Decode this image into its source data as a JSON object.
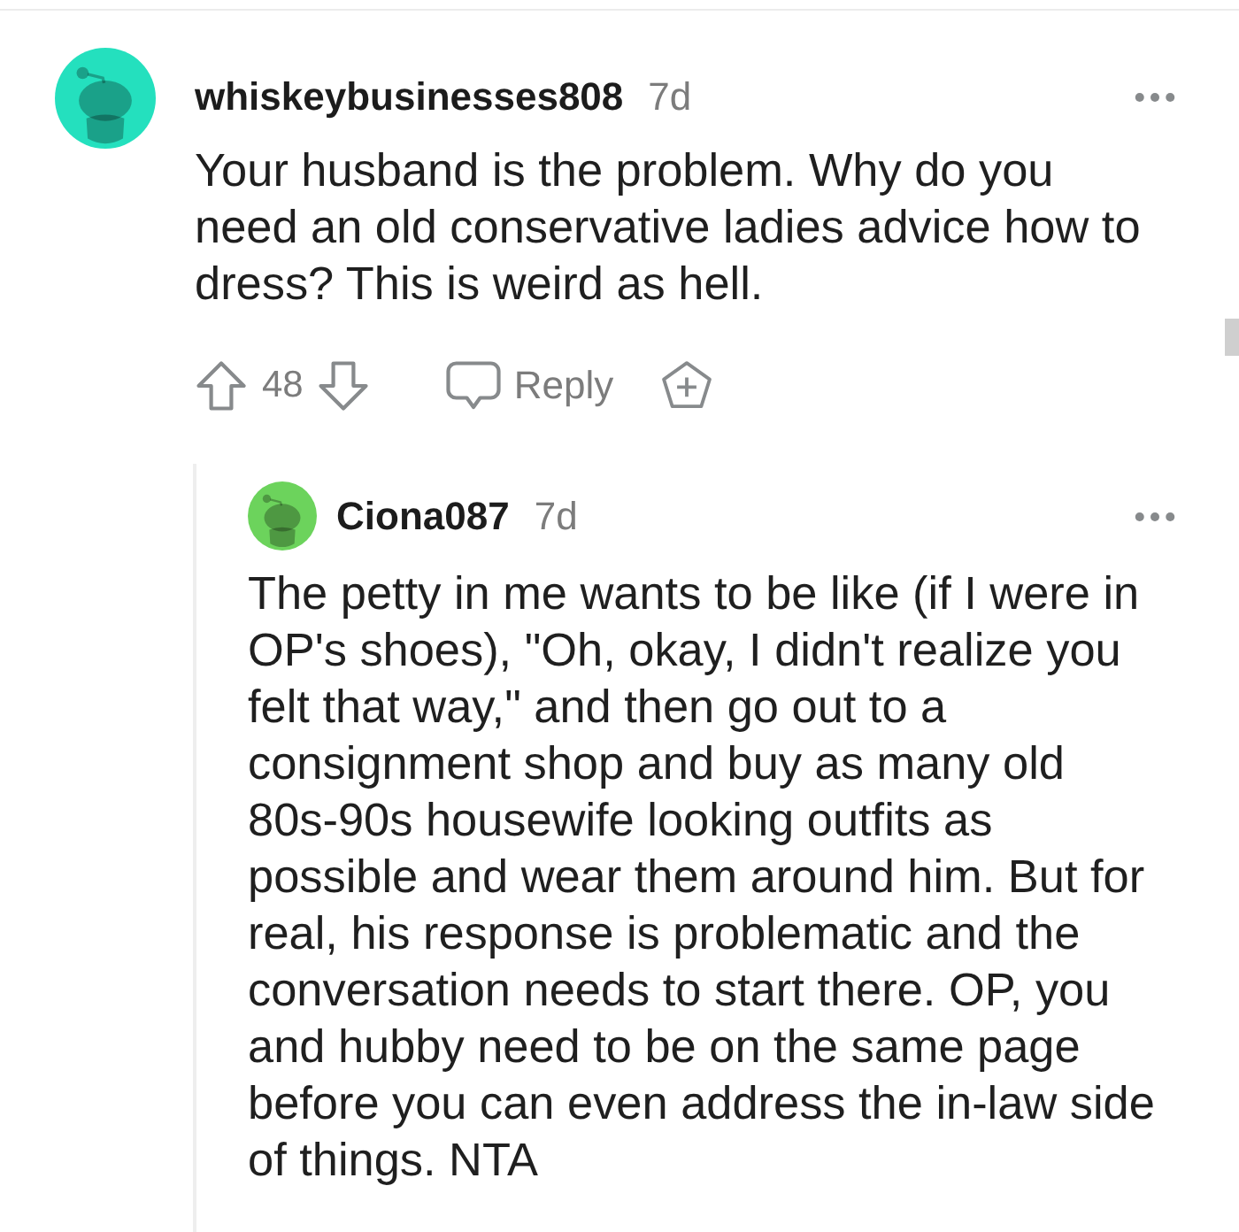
{
  "comments": [
    {
      "author": "whiskeybusinesses808",
      "age": "7d",
      "color": "#24e0be",
      "body": "Your husband is the problem. Why do you need an old conservative ladies advice how to dress? This is weird as hell.",
      "score": "48",
      "reply_label": "Reply",
      "replies": [
        {
          "author": "Ciona087",
          "age": "7d",
          "color": "#6cd35c",
          "body": "The petty in me wants to be like (if I were in OP's shoes), \"Oh, okay, I didn't realize you felt that way,\" and then go out to a consignment shop and buy as many old 80s-90s housewife looking outfits as possible and wear them around him. But for real, his response is problematic and the conversation needs to start there. OP, you and hubby need to be on the same page before you can even address the in-law side of things. NTA"
        }
      ]
    }
  ]
}
